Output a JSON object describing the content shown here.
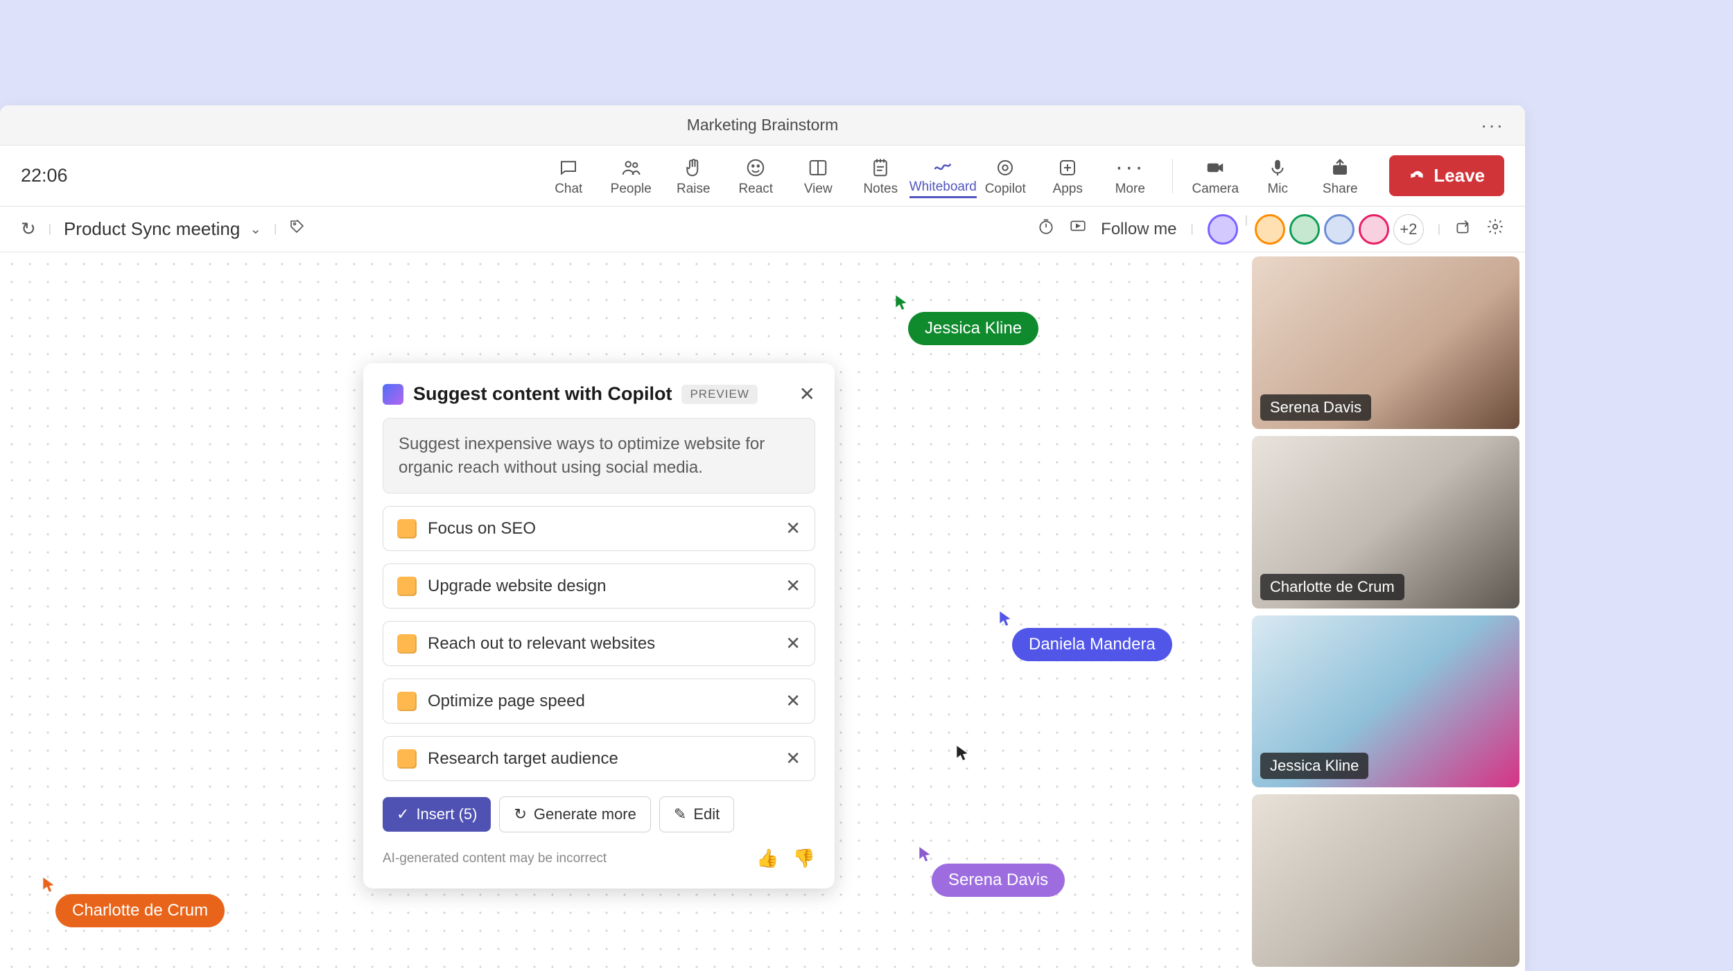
{
  "titlebar": {
    "title": "Marketing Brainstorm"
  },
  "timer": "22:06",
  "toolbar": {
    "chat": "Chat",
    "people": "People",
    "raise": "Raise",
    "react": "React",
    "view": "View",
    "notes": "Notes",
    "whiteboard": "Whiteboard",
    "copilot": "Copilot",
    "apps": "Apps",
    "more": "More",
    "camera": "Camera",
    "mic": "Mic",
    "share": "Share",
    "leave": "Leave"
  },
  "subbar": {
    "meeting_name": "Product Sync meeting",
    "follow_me": "Follow me",
    "extra_count": "+2"
  },
  "cursors": {
    "jessica": {
      "name": "Jessica Kline",
      "color": "#0f8b2e"
    },
    "daniela": {
      "name": "Daniela Mandera",
      "color": "#5156e9"
    },
    "serena": {
      "name": "Serena Davis",
      "color": "#8c5ad1"
    },
    "charlotte": {
      "name": "Charlotte de Crum",
      "color": "#e8641a"
    }
  },
  "copilot": {
    "title": "Suggest content with Copilot",
    "badge": "PREVIEW",
    "prompt": "Suggest inexpensive ways to optimize website for organic reach without using social media.",
    "items": [
      "Focus on SEO",
      "Upgrade website design",
      "Reach out to relevant websites",
      "Optimize page speed",
      "Research target audience"
    ],
    "insert": "Insert (5)",
    "generate": "Generate more",
    "edit": "Edit",
    "disclaimer": "AI-generated content may be incorrect"
  },
  "webcams": [
    {
      "name": "Serena Davis"
    },
    {
      "name": "Charlotte de Crum"
    },
    {
      "name": "Jessica Kline"
    },
    {
      "name": ""
    }
  ]
}
